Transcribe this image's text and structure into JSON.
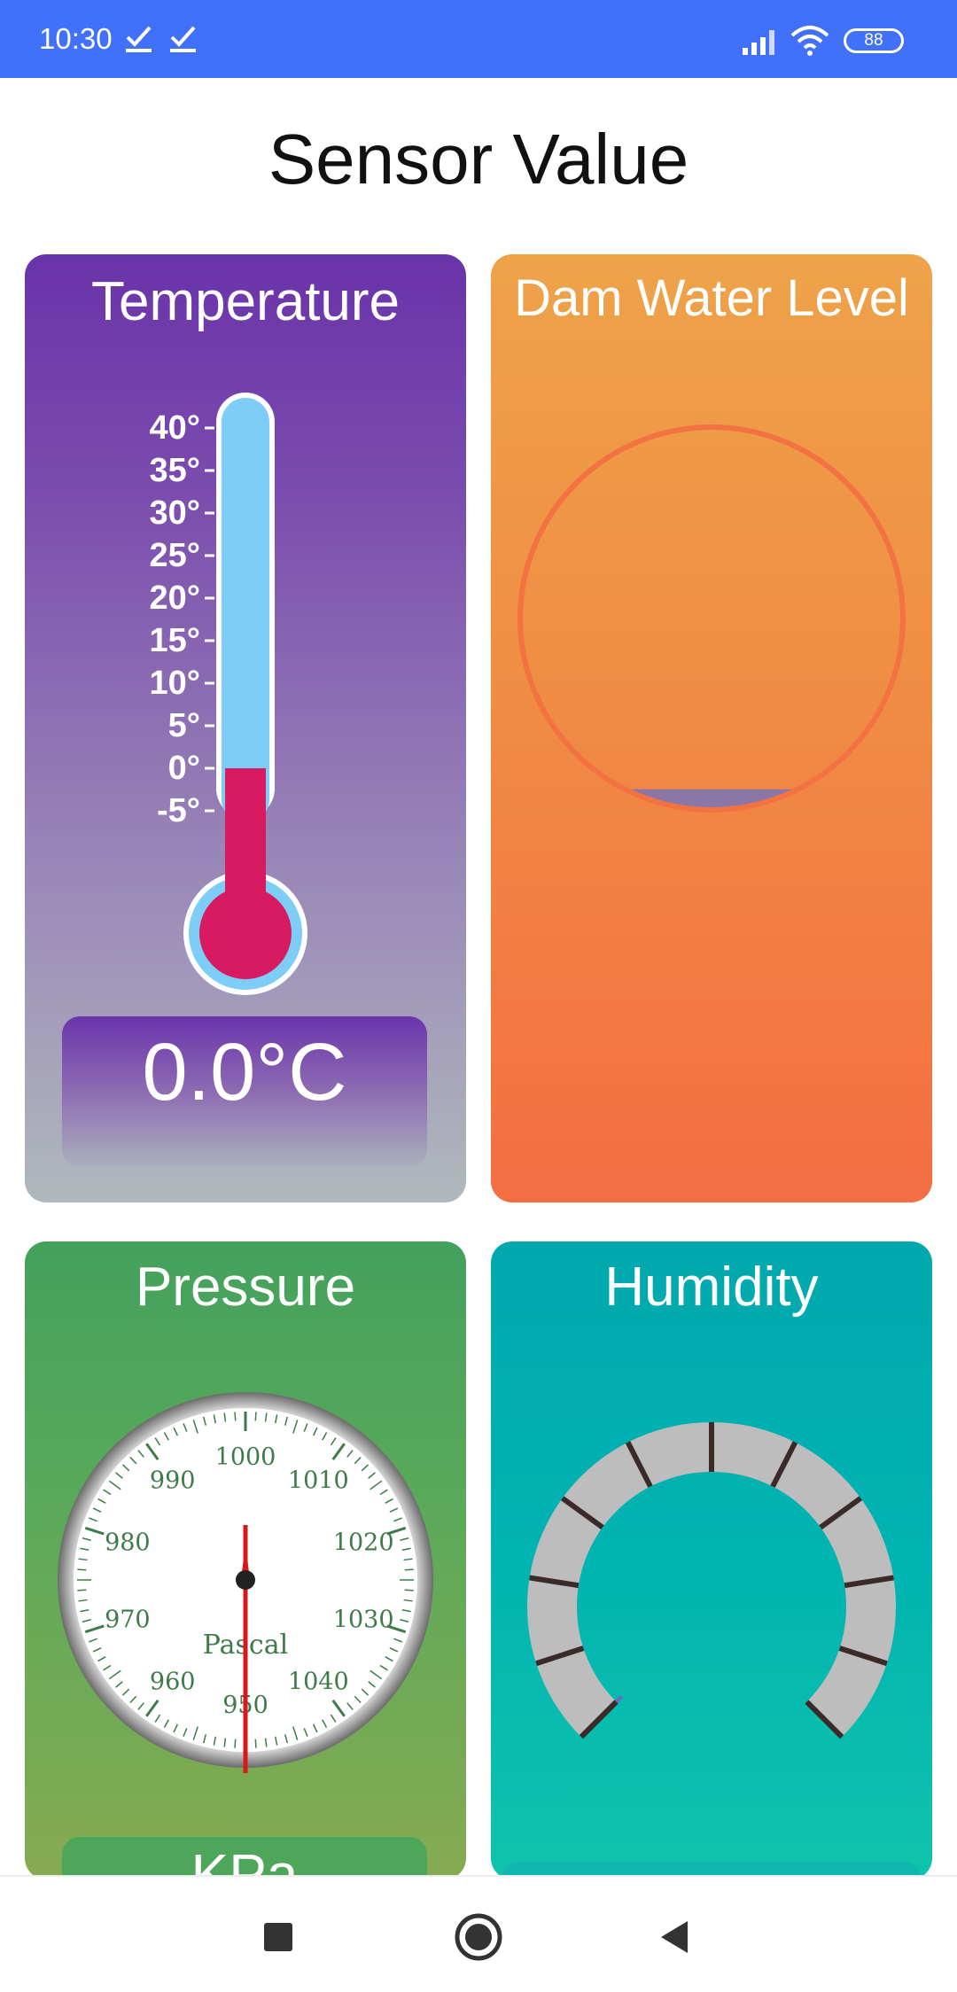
{
  "status_bar": {
    "time": "10:30",
    "battery": "88",
    "icons": [
      "check-icon",
      "check-icon",
      "signal-icon",
      "wifi-icon",
      "battery-icon"
    ]
  },
  "page": {
    "title": "Sensor Value"
  },
  "cards": {
    "temperature": {
      "title": "Temperature",
      "scale_labels": [
        "40°",
        "35°",
        "30°",
        "25°",
        "20°",
        "15°",
        "10°",
        "5°",
        "0°",
        "-5°"
      ],
      "value_text": "0.0°C",
      "value": 0.0,
      "scale_min": -10,
      "scale_max": 40,
      "mercury_color": "#d81b60",
      "tube_color": "#7dcdf6"
    },
    "dam_water_level": {
      "title": "Dam Water Level",
      "level_fraction": 0.05,
      "ring_color": "#f37242",
      "water_color": "#8a77a6"
    },
    "pressure": {
      "title": "Pressure",
      "dial_labels": [
        "1000",
        "1010",
        "1020",
        "1030",
        "1040",
        "950",
        "960",
        "970",
        "980",
        "990"
      ],
      "dial_caption": "Pascal",
      "unit": "KPa",
      "needle_value": 950,
      "needle_color": "#d61a1a"
    },
    "humidity": {
      "title": "Humidity",
      "gauge_track_color": "#bdbdbd",
      "tick_color": "#3a2a2a",
      "value_fraction": 0.0
    }
  },
  "nav": {
    "buttons": [
      "recent-apps-button",
      "home-button",
      "back-button"
    ]
  }
}
